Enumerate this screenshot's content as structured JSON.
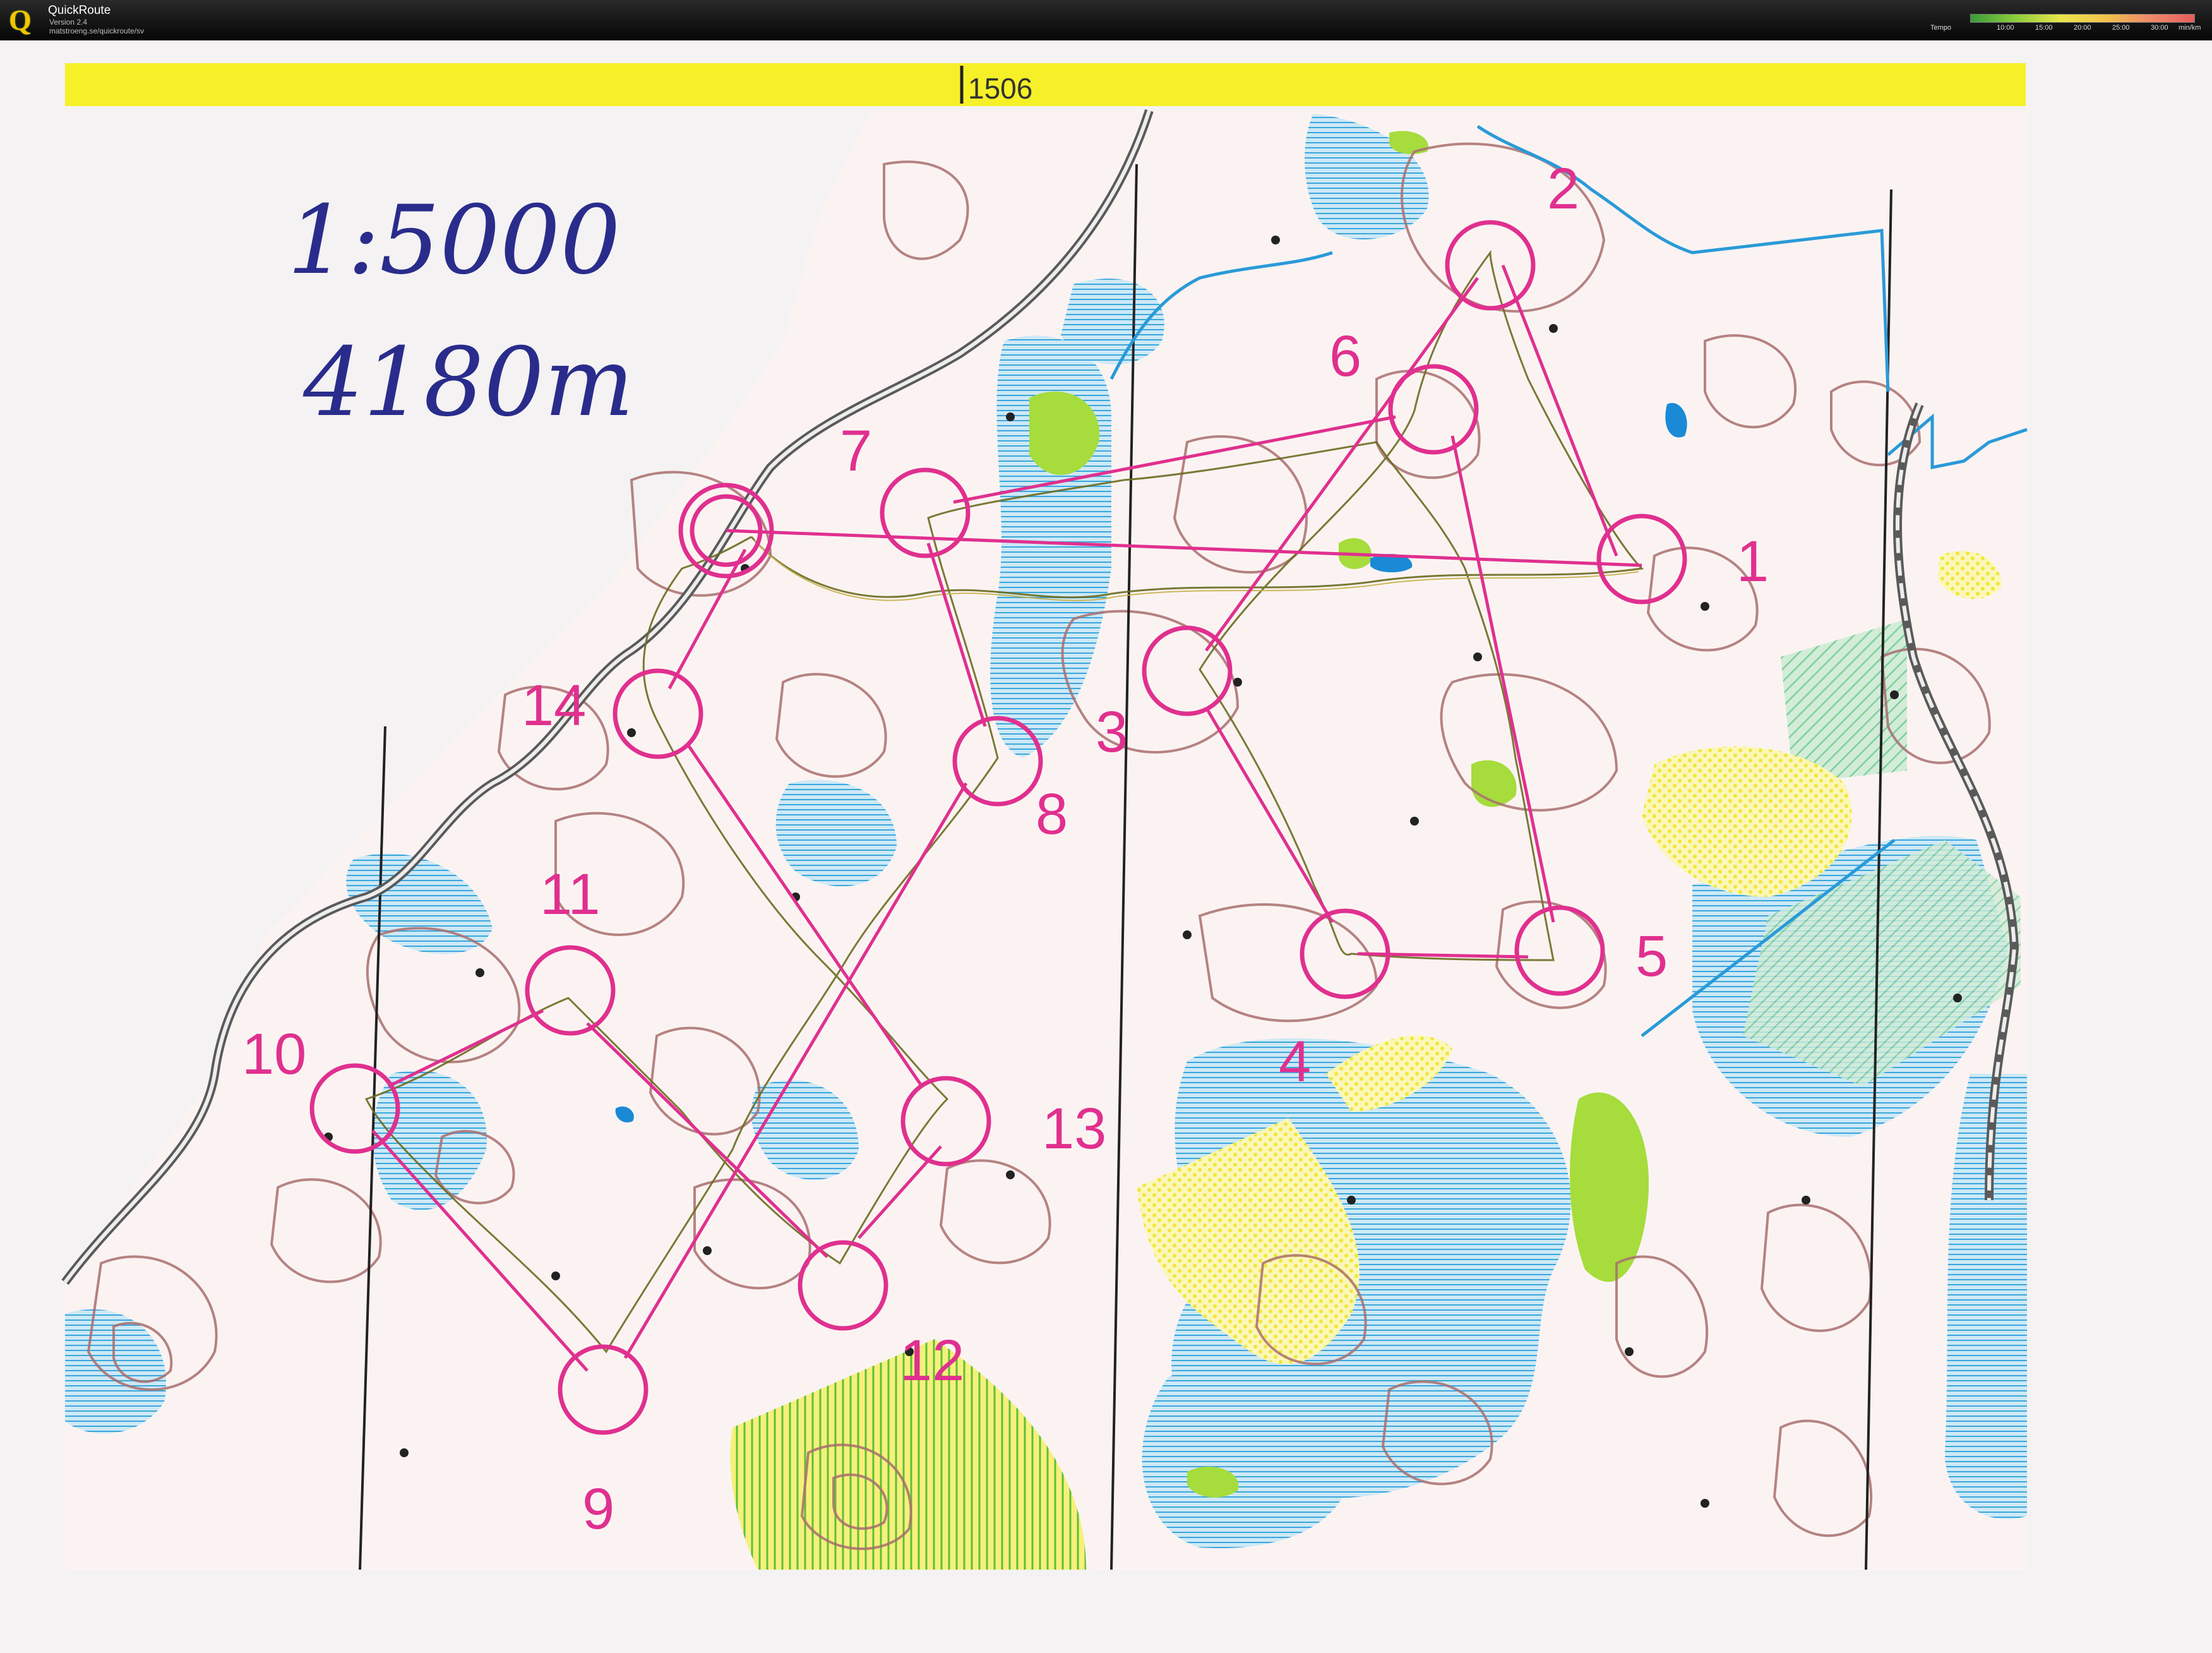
{
  "app": {
    "name": "QuickRoute",
    "version": "Version 2.4",
    "url": "matstroeng.se/quickroute/sv",
    "logo_letter": "Q",
    "legend": {
      "title": "Tempo",
      "ticks": [
        "10:00",
        "15:00",
        "20:00",
        "25:00",
        "30:00"
      ],
      "unit": "min/km"
    }
  },
  "map": {
    "header_label": "1506",
    "scale_note": "1:5000",
    "length_note": "4180m",
    "colors": {
      "paper": "#f4f2f2",
      "course": "#e0308f",
      "contour": "#a86e6e",
      "water": "#4ab0e0",
      "green": "#a6dc3c",
      "yellow": "#f4ee3c",
      "route": "#7a7a2a",
      "header_bar": "#f6f028"
    },
    "controls": [
      {
        "number": "1"
      },
      {
        "number": "2"
      },
      {
        "number": "3"
      },
      {
        "number": "4"
      },
      {
        "number": "5"
      },
      {
        "number": "6"
      },
      {
        "number": "7"
      },
      {
        "number": "8"
      },
      {
        "number": "9"
      },
      {
        "number": "10"
      },
      {
        "number": "11"
      },
      {
        "number": "12"
      },
      {
        "number": "13"
      },
      {
        "number": "14"
      }
    ]
  }
}
